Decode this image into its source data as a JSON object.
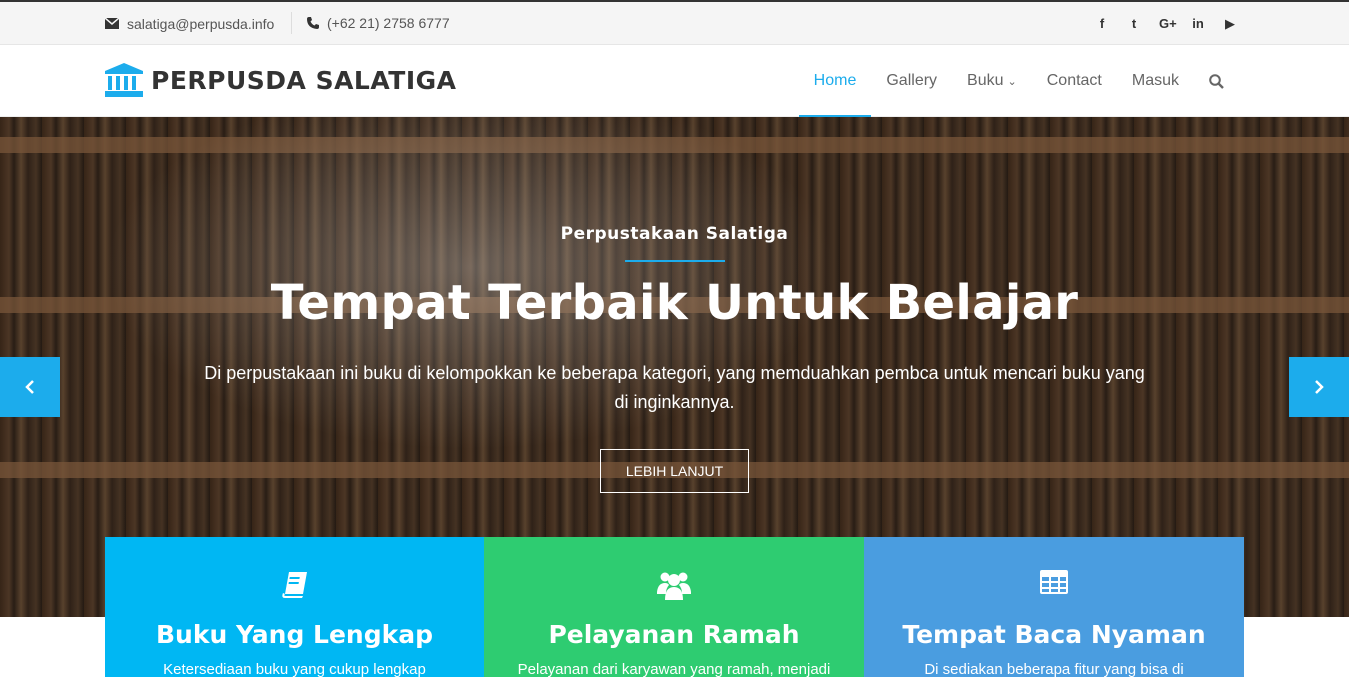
{
  "topbar": {
    "email": "salatiga@perpusda.info",
    "phone": "(+62 21) 2758 6777",
    "socials": [
      "facebook-icon",
      "twitter-icon",
      "google-plus-icon",
      "linkedin-icon",
      "youtube-icon"
    ],
    "social_glyphs": [
      "f",
      "t",
      "G+",
      "in",
      "▶"
    ]
  },
  "brand": {
    "name": "PERPUSDA SALATIGA",
    "accent": "#1cacec"
  },
  "nav": {
    "home": "Home",
    "gallery": "Gallery",
    "buku": "Buku",
    "contact": "Contact",
    "masuk": "Masuk"
  },
  "hero": {
    "kicker": "Perpustakaan Salatiga",
    "title": "Tempat Terbaik Untuk Belajar",
    "description": "Di perpustakaan ini buku di kelompokkan ke beberapa kategori, yang memduahkan pembca untuk mencari buku yang di inginkannya.",
    "button": "LEBIH LANJUT"
  },
  "features": [
    {
      "title": "Buku Yang Lengkap",
      "text": "Ketersediaan buku yang cukup lengkap",
      "icon": "book-icon",
      "color": "#00b7f3"
    },
    {
      "title": "Pelayanan Ramah",
      "text": "Pelayanan dari karyawan yang ramah, menjadi",
      "icon": "users-icon",
      "color": "#2ecc71"
    },
    {
      "title": "Tempat Baca Nyaman",
      "text": "Di sediakan beberapa fitur yang bisa di",
      "icon": "table-icon",
      "color": "#4a9de0"
    }
  ]
}
